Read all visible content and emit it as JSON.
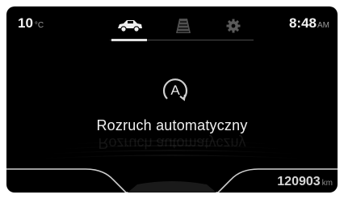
{
  "status_bar": {
    "temperature": "10",
    "temperature_unit": "°C",
    "time": "8:48",
    "time_period": "AM"
  },
  "tabs": [
    {
      "name": "car-tab",
      "icon": "car-icon",
      "active": true
    },
    {
      "name": "lane-tab",
      "icon": "lane-road-icon",
      "active": false
    },
    {
      "name": "settings-tab",
      "icon": "gear-icon",
      "active": false
    }
  ],
  "main": {
    "icon": "auto-start-stop-icon",
    "icon_letter": "A",
    "message": "Rozruch automatyczny"
  },
  "odometer": {
    "value": "120903",
    "unit": "km"
  },
  "colors": {
    "background": "#000000",
    "text": "#f0f0f0",
    "inactive_icon": "#5a5a5a",
    "active_icon": "#f0f0f0"
  }
}
